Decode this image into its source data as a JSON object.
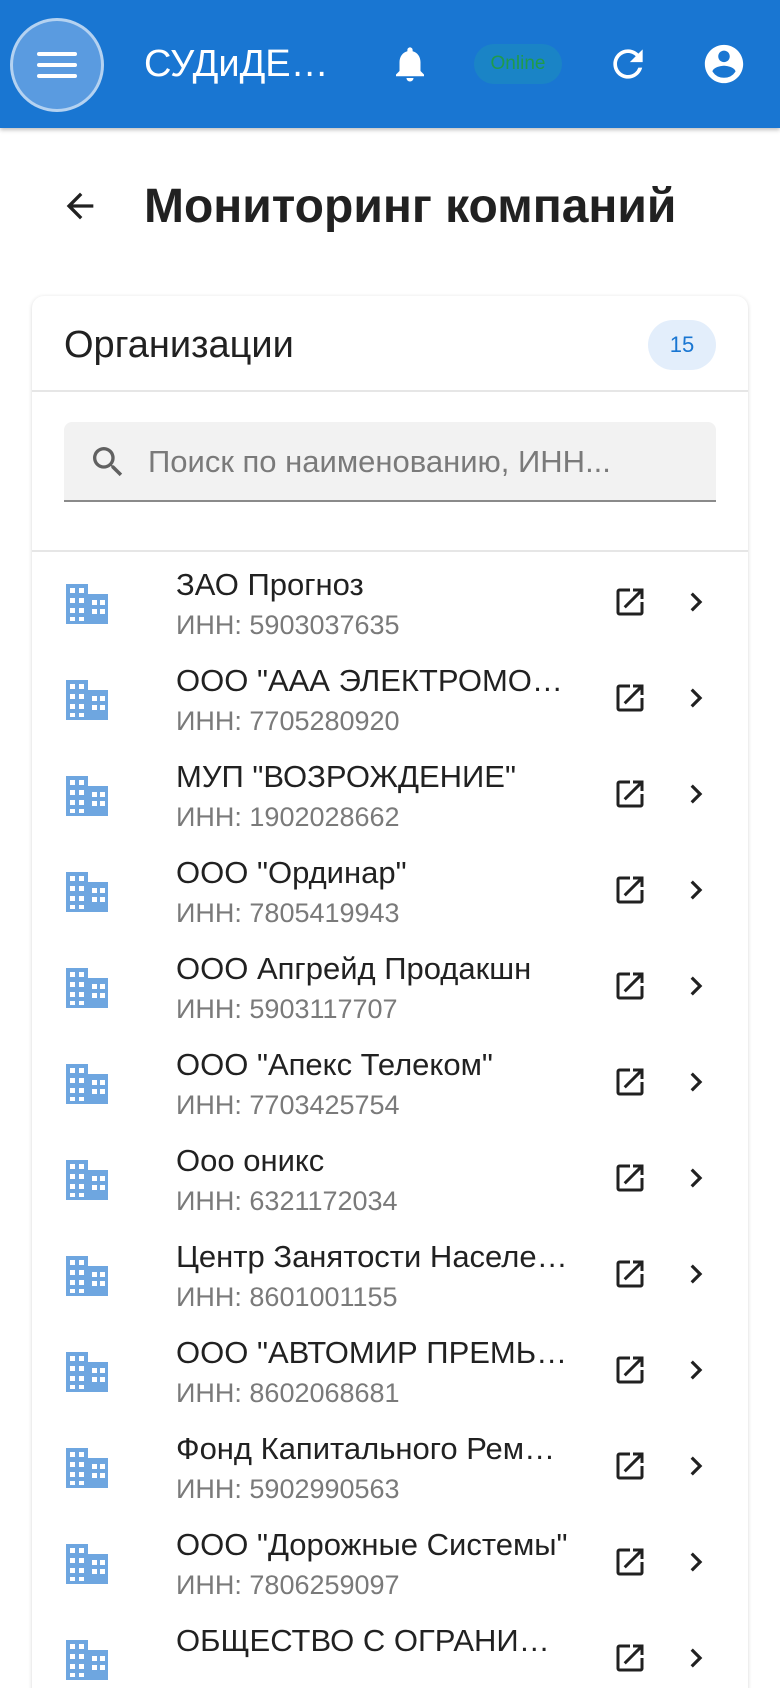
{
  "appbar": {
    "title": "СУДиДЕ…",
    "status": "Online"
  },
  "page": {
    "title": "Мониторинг компаний"
  },
  "card": {
    "title": "Организации",
    "count": "15"
  },
  "search": {
    "placeholder": "Поиск по наименованию, ИНН..."
  },
  "organizations": [
    {
      "name": "ЗАО Прогноз",
      "inn": "ИНН: 5903037635"
    },
    {
      "name": "ООО \"ААА ЭЛЕКТРОМО…",
      "inn": "ИНН: 7705280920"
    },
    {
      "name": "МУП \"ВОЗРОЖДЕНИЕ\"",
      "inn": "ИНН: 1902028662"
    },
    {
      "name": "ООО \"Ординар\"",
      "inn": "ИНН: 7805419943"
    },
    {
      "name": "ООО Апгрейд Продакшн",
      "inn": "ИНН: 5903117707"
    },
    {
      "name": "ООО \"Апекс Телеком\"",
      "inn": "ИНН: 7703425754"
    },
    {
      "name": "Ооо оникс",
      "inn": "ИНН: 6321172034"
    },
    {
      "name": "Центр Занятости Населе…",
      "inn": "ИНН: 8601001155"
    },
    {
      "name": "ООО \"АВТОМИР ПРЕМЬ…",
      "inn": "ИНН: 8602068681"
    },
    {
      "name": "Фонд Капитального Рем…",
      "inn": "ИНН: 5902990563"
    },
    {
      "name": "ООО \"Дорожные Системы\"",
      "inn": "ИНН: 7806259097"
    },
    {
      "name": "ОБЩЕСТВО С ОГРАНИ…",
      "inn": ""
    }
  ],
  "colors": {
    "primary": "#1976d2",
    "icon_building": "#6ea6e0",
    "online_text": "#1f9a4c"
  },
  "icons": {
    "menu": "hamburger-icon",
    "bell": "bell-icon",
    "refresh": "refresh-icon",
    "account": "account-circle-icon",
    "back": "arrow-back-icon",
    "search": "search-icon",
    "building": "building-icon",
    "open": "open-in-new-icon",
    "chevron": "chevron-right-icon"
  }
}
